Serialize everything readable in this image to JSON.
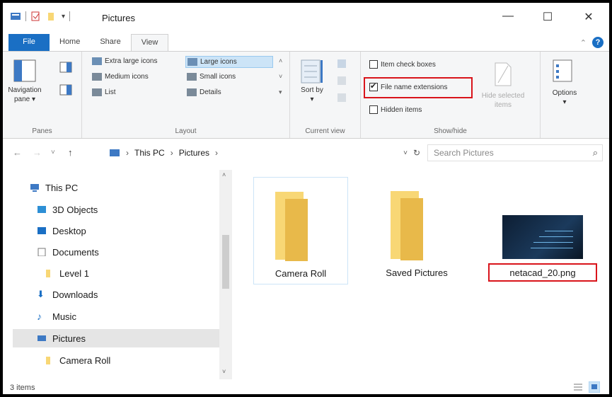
{
  "window": {
    "title": "Pictures",
    "minimize": "—",
    "maximize": "☐",
    "close": "✕"
  },
  "ribbon_tabs": [
    {
      "label": "File"
    },
    {
      "label": "Home"
    },
    {
      "label": "Share"
    },
    {
      "label": "View"
    }
  ],
  "panes": {
    "navigation_pane": "Navigation pane ▾",
    "group_label": "Panes"
  },
  "layout": {
    "items": [
      "Extra large icons",
      "Large icons",
      "Medium icons",
      "Small icons",
      "List",
      "Details"
    ],
    "selected": "Large icons",
    "group_label": "Layout"
  },
  "current_view": {
    "sort_by": "Sort by ▾",
    "group_label": "Current view"
  },
  "show_hide": {
    "item_check_boxes": "Item check boxes",
    "file_name_extensions": "File name extensions",
    "hidden_items": "Hidden items",
    "hide_selected": "Hide selected items",
    "group_label": "Show/hide",
    "checked": {
      "item_check_boxes": false,
      "file_name_extensions": true,
      "hidden_items": false
    }
  },
  "options": {
    "label": "Options"
  },
  "address": {
    "segments": [
      "This PC",
      "Pictures"
    ],
    "search_placeholder": "Search Pictures"
  },
  "nav_items": [
    {
      "label": "This PC",
      "icon": "computer-icon"
    },
    {
      "label": "3D Objects",
      "icon": "3d-objects-icon"
    },
    {
      "label": "Desktop",
      "icon": "desktop-icon"
    },
    {
      "label": "Documents",
      "icon": "documents-icon"
    },
    {
      "label": "Level 1",
      "icon": "folder-icon"
    },
    {
      "label": "Downloads",
      "icon": "downloads-icon"
    },
    {
      "label": "Music",
      "icon": "music-icon"
    },
    {
      "label": "Pictures",
      "icon": "pictures-icon",
      "selected": true
    },
    {
      "label": "Camera Roll",
      "icon": "folder-icon"
    }
  ],
  "files": [
    {
      "label": "Camera Roll",
      "type": "folder"
    },
    {
      "label": "Saved Pictures",
      "type": "folder"
    },
    {
      "label": "netacad_20.png",
      "type": "image"
    }
  ],
  "status": {
    "item_count": "3 items"
  },
  "colors": {
    "accent": "#1a6fc4",
    "highlight_red": "#d9141b",
    "folder_yellow": "#f8d775"
  }
}
